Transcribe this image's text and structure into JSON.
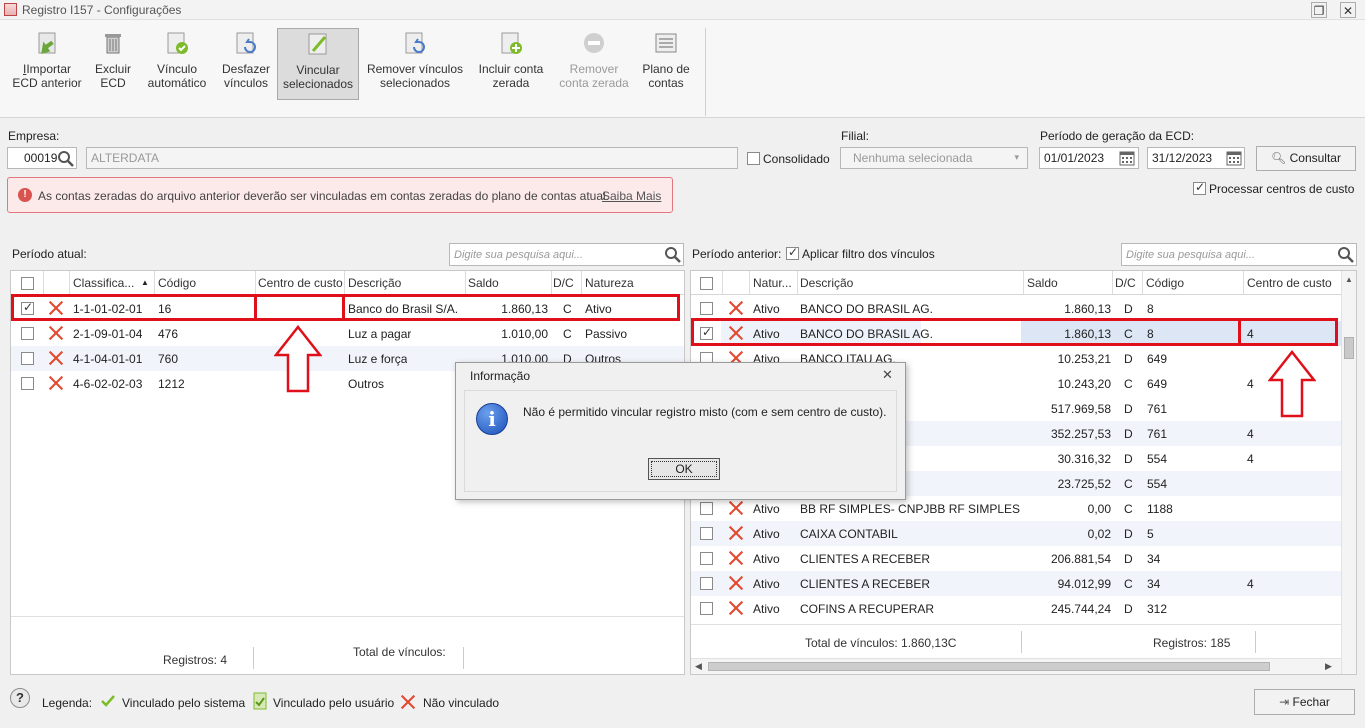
{
  "window": {
    "title": "Registro I157 - Configurações"
  },
  "ribbon": {
    "buttons": [
      {
        "line1": "Importar",
        "line2": "ECD anterior"
      },
      {
        "line1": "Excluir",
        "line2": "ECD"
      },
      {
        "line1": "Vínculo",
        "line2": "automático"
      },
      {
        "line1": "Desfazer",
        "line2": "vínculos"
      },
      {
        "line1": "Vincular",
        "line2": "selecionados"
      },
      {
        "line1": "Remover vínculos",
        "line2": "selecionados"
      },
      {
        "line1": "Incluir conta",
        "line2": "zerada"
      },
      {
        "line1": "Remover",
        "line2": "conta zerada"
      },
      {
        "line1": "Plano de",
        "line2": "contas"
      }
    ]
  },
  "form": {
    "empresa_label": "Empresa:",
    "empresa_code": "00019",
    "empresa_name": "ALTERDATA",
    "consolidado_label": "Consolidado",
    "filial_label": "Filial:",
    "filial_value": "Nenhuma selecionada",
    "periodo_label": "Período de geração da ECD:",
    "date_from": "01/01/2023",
    "date_to": "31/12/2023",
    "consultar_label": "Consultar",
    "processar_label": "Processar centros de custo"
  },
  "alert": {
    "text": "As contas zeradas do arquivo anterior deverão ser vinculadas em contas zeradas do plano de contas atual.",
    "link": "Saiba Mais"
  },
  "left": {
    "title": "Período atual:",
    "search_placeholder": "Digite sua pesquisa aqui...",
    "headers": [
      "Classifica...",
      "Código",
      "Centro de custo",
      "Descrição",
      "Saldo",
      "D/C",
      "Natureza"
    ],
    "rows": [
      {
        "checked": true,
        "classif": "1-1-01-02-01",
        "codigo": "16",
        "centro": "",
        "descricao": "Banco do Brasil S/A.",
        "saldo": "1.860,13",
        "dc": "C",
        "natureza": "Ativo"
      },
      {
        "checked": false,
        "classif": "2-1-09-01-04",
        "codigo": "476",
        "centro": "",
        "descricao": "Luz a pagar",
        "saldo": "1.010,00",
        "dc": "C",
        "natureza": "Passivo"
      },
      {
        "checked": false,
        "classif": "4-1-04-01-01",
        "codigo": "760",
        "centro": "",
        "descricao": "Luz e força",
        "saldo": "1.010,00",
        "dc": "D",
        "natureza": "Outros"
      },
      {
        "checked": false,
        "classif": "4-6-02-02-03",
        "codigo": "1212",
        "centro": "",
        "descricao": "Outros",
        "saldo": "",
        "dc": "",
        "natureza": ""
      }
    ],
    "footer_registros": "Registros: 4",
    "footer_vinculos": "Total de vínculos:"
  },
  "right": {
    "title": "Período anterior:",
    "filter_label": "Aplicar filtro dos vínculos",
    "search_placeholder": "Digite sua pesquisa aqui...",
    "headers": [
      "Natur...",
      "Descrição",
      "Saldo",
      "D/C",
      "Código",
      "Centro de custo"
    ],
    "rows": [
      {
        "checked": false,
        "natureza": "Ativo",
        "descricao": "BANCO DO BRASIL AG.",
        "saldo": "1.860,13",
        "dc": "D",
        "codigo": "8",
        "centro": ""
      },
      {
        "checked": true,
        "natureza": "Ativo",
        "descricao": "BANCO DO BRASIL AG.",
        "saldo": "1.860,13",
        "dc": "C",
        "codigo": "8",
        "centro": "4"
      },
      {
        "checked": false,
        "natureza": "Ativo",
        "descricao": "BANCO ITAU AG.",
        "saldo": "10.253,21",
        "dc": "D",
        "codigo": "649",
        "centro": ""
      },
      {
        "checked": false,
        "natureza": "",
        "descricao": "",
        "saldo": "10.243,20",
        "dc": "C",
        "codigo": "649",
        "centro": "4"
      },
      {
        "checked": false,
        "natureza": "",
        "descricao": "",
        "saldo": "517.969,58",
        "dc": "D",
        "codigo": "761",
        "centro": ""
      },
      {
        "checked": false,
        "natureza": "",
        "descricao": "",
        "saldo": "352.257,53",
        "dc": "D",
        "codigo": "761",
        "centro": "4"
      },
      {
        "checked": false,
        "natureza": "",
        "descricao": "",
        "saldo": "30.316,32",
        "dc": "D",
        "codigo": "554",
        "centro": "4"
      },
      {
        "checked": false,
        "natureza": "",
        "descricao": "",
        "saldo": "23.725,52",
        "dc": "C",
        "codigo": "554",
        "centro": ""
      },
      {
        "checked": false,
        "natureza": "Ativo",
        "descricao": "BB RF SIMPLES- CNPJBB RF SIMPLES",
        "saldo": "0,00",
        "dc": "C",
        "codigo": "1188",
        "centro": ""
      },
      {
        "checked": false,
        "natureza": "Ativo",
        "descricao": "CAIXA CONTABIL",
        "saldo": "0,02",
        "dc": "D",
        "codigo": "5",
        "centro": ""
      },
      {
        "checked": false,
        "natureza": "Ativo",
        "descricao": "CLIENTES A RECEBER",
        "saldo": "206.881,54",
        "dc": "D",
        "codigo": "34",
        "centro": ""
      },
      {
        "checked": false,
        "natureza": "Ativo",
        "descricao": "CLIENTES A RECEBER",
        "saldo": "94.012,99",
        "dc": "C",
        "codigo": "34",
        "centro": "4"
      },
      {
        "checked": false,
        "natureza": "Ativo",
        "descricao": "COFINS A RECUPERAR",
        "saldo": "245.744,24",
        "dc": "D",
        "codigo": "312",
        "centro": ""
      }
    ],
    "footer_vinculos": "Total de vínculos: 1.860,13C",
    "footer_registros": "Registros: 185"
  },
  "dialog": {
    "title": "Informação",
    "message": "Não é permitido vincular registro misto (com e sem centro de custo).",
    "ok": "OK"
  },
  "legend": {
    "label": "Legenda:",
    "sistema": "Vinculado pelo sistema",
    "usuario": "Vinculado pelo usuário",
    "nao": "Não vinculado",
    "fechar": "Fechar"
  },
  "colors": {
    "accent_red": "#e0101a",
    "x_icon": "#e2462c",
    "check_green": "#7dbb2b",
    "row_alt": "#f1f4fa",
    "selected_row": "#dce6f5"
  }
}
